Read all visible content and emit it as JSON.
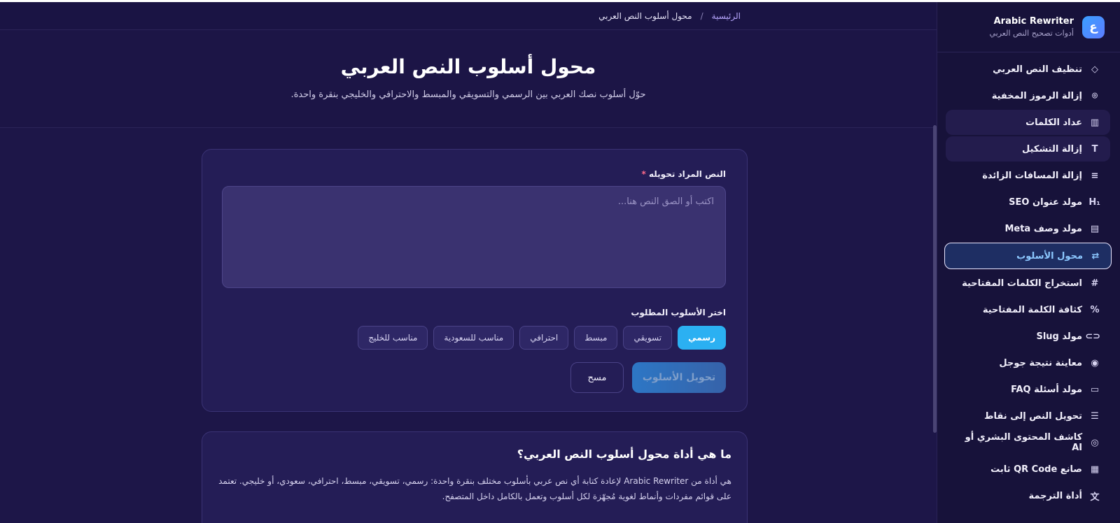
{
  "brand": {
    "logo_letter": "ع",
    "name": "Arabic Rewriter",
    "subtitle": "أدوات تصحيح النص العربي"
  },
  "sidebar": {
    "items": [
      {
        "label": "تنظيف النص العربي",
        "icon": "eraser-icon",
        "glyph": "◇"
      },
      {
        "label": "إزالة الرموز المخفية",
        "icon": "scan-icon",
        "glyph": "⌾"
      },
      {
        "label": "عداد الكلمات",
        "icon": "bar-chart-icon",
        "glyph": "▥"
      },
      {
        "label": "إزالة التشكيل",
        "icon": "type-icon",
        "glyph": "T"
      },
      {
        "label": "إزالة المسافات الزائدة",
        "icon": "lines-icon",
        "glyph": "≡"
      },
      {
        "label": "مولد عنوان SEO",
        "icon": "heading-icon",
        "glyph": "H₁"
      },
      {
        "label": "مولد وصف Meta",
        "icon": "file-text-icon",
        "glyph": "▤"
      },
      {
        "label": "محول الأسلوب",
        "icon": "repeat-icon",
        "glyph": "⇄"
      },
      {
        "label": "استخراج الكلمات المفتاحية",
        "icon": "hash-icon",
        "glyph": "#"
      },
      {
        "label": "كثافة الكلمة المفتاحية",
        "icon": "percent-icon",
        "glyph": "%"
      },
      {
        "label": "مولد Slug",
        "icon": "link-icon",
        "glyph": "⊂⊃"
      },
      {
        "label": "معاينة نتيجة جوجل",
        "icon": "eye-icon",
        "glyph": "◉"
      },
      {
        "label": "مولد أسئلة FAQ",
        "icon": "message-icon",
        "glyph": "▭"
      },
      {
        "label": "تحويل النص إلى نقاط",
        "icon": "list-icon",
        "glyph": "☰"
      },
      {
        "label": "كاشف المحتوى البشري أو AI",
        "icon": "scan-face-icon",
        "glyph": "◎"
      },
      {
        "label": "صانع QR Code ثابت",
        "icon": "qr-code-icon",
        "glyph": "▦"
      },
      {
        "label": "أداة الترجمة",
        "icon": "languages-icon",
        "glyph": "文"
      }
    ]
  },
  "breadcrumb": {
    "home": "الرئيسية",
    "separator": "/",
    "current": "محول أسلوب النص العربي"
  },
  "hero": {
    "title": "محول أسلوب النص العربي",
    "subtitle": "حوّل أسلوب نصك العربي بين الرسمي والتسويقي والمبسط والاحترافي والخليجي بنقرة واحدة."
  },
  "form": {
    "text_label": "النص المراد تحويله",
    "required_mark": "*",
    "placeholder": "اكتب أو الصق النص هنا...",
    "style_label": "اختر الأسلوب المطلوب",
    "styles": [
      "رسمي",
      "تسويقي",
      "مبسط",
      "احترافي",
      "مناسب للسعودية",
      "مناسب للخليج"
    ],
    "convert_button": "تحويل الأسلوب",
    "clear_button": "مسح"
  },
  "info": {
    "heading": "ما هي أداة محول أسلوب النص العربي؟",
    "body": "هي أداة من Arabic Rewriter لإعادة كتابة أي نص عربي بأسلوب مختلف بنقرة واحدة: رسمي، تسويقي، مبسط، احترافي، سعودي، أو خليجي. تعتمد على قوائم مفردات وأنماط لغوية مُجهّزة لكل أسلوب وتعمل بالكامل داخل المتصفح."
  }
}
